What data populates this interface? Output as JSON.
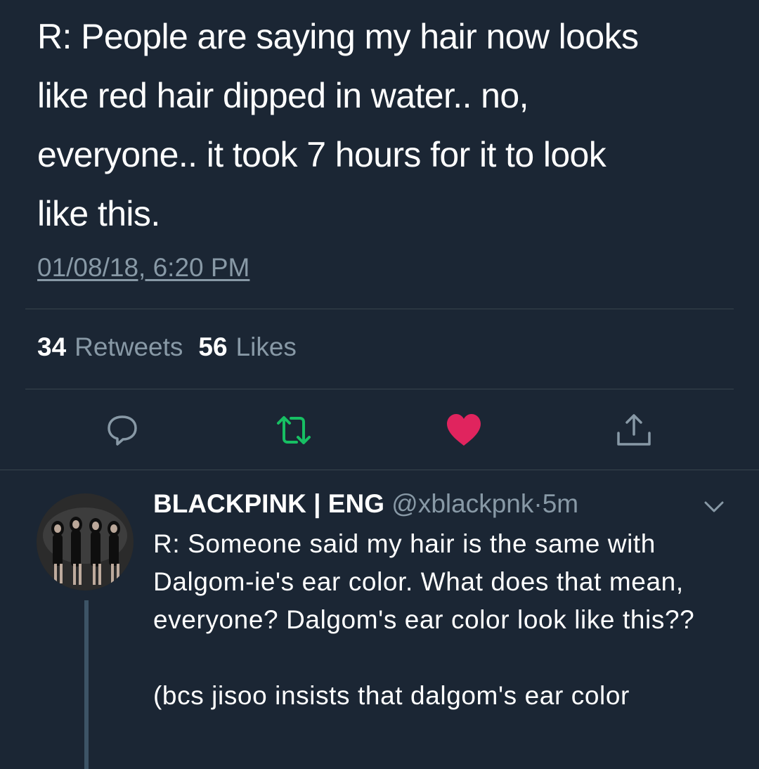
{
  "tweet": {
    "text": "R: People are saying my hair now looks\nlike red hair dipped in water.. no,\neveryone.. it took 7 hours for it to look\nlike this.",
    "timestamp": "01/08/18, 6:20 PM",
    "retweets_count": "34",
    "retweets_label": "Retweets",
    "likes_count": "56",
    "likes_label": "Likes"
  },
  "actions": {
    "reply_icon": "reply-icon",
    "retweet_icon": "retweet-icon",
    "like_icon": "heart-icon",
    "share_icon": "share-icon",
    "retweet_color": "#17bf63",
    "like_color": "#e0245e"
  },
  "reply": {
    "name": "BLACKPINK | ENG",
    "handle": "@xblackpnk",
    "separator": "·",
    "time": "5m",
    "text_line1": "R: Someone said my hair is the same with Dalgom-ie's ear color. What does that mean, everyone? Dalgom's ear color look like this??",
    "text_line2": "(bcs jisoo insists that dalgom's ear color"
  },
  "colors": {
    "background": "#1b2634",
    "secondary_text": "#8899a6",
    "divider": "#38444d"
  }
}
